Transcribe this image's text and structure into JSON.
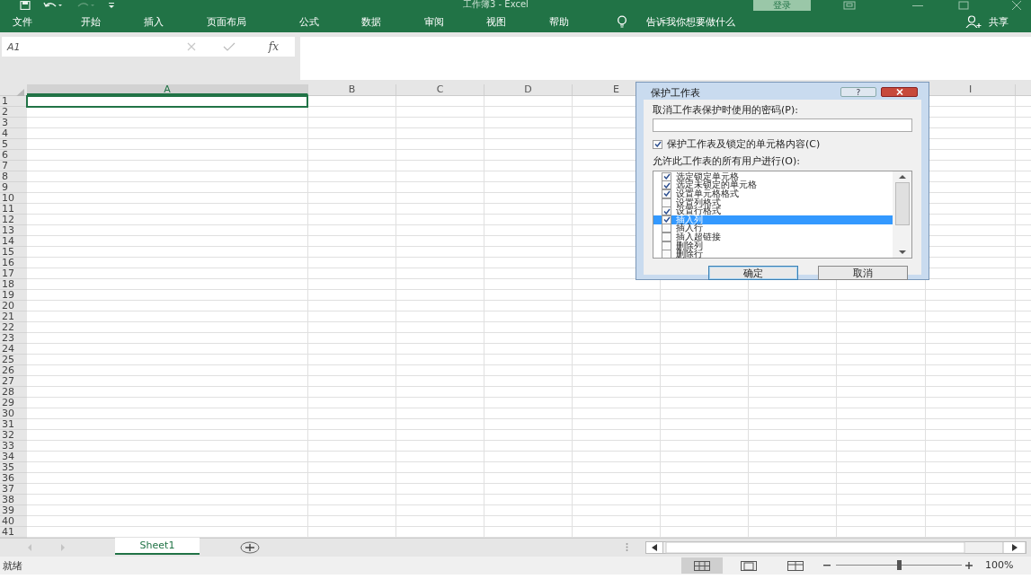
{
  "title_bar": {
    "title": "工作簿3  -  Excel",
    "sign_in": "登录"
  },
  "ribbon_tabs": [
    "文件",
    "开始",
    "插入",
    "页面布局",
    "公式",
    "数据",
    "审阅",
    "视图",
    "帮助"
  ],
  "tell_me": "告诉我你想要做什么",
  "share": "共享",
  "name_box": "A1",
  "formula_label": "fx",
  "columns": [
    {
      "label": "A",
      "selected": true
    },
    {
      "label": "B",
      "selected": false
    },
    {
      "label": "C",
      "selected": false
    },
    {
      "label": "D",
      "selected": false
    },
    {
      "label": "E",
      "selected": false
    },
    {
      "label": "I",
      "selected": false
    }
  ],
  "rows": [
    "1",
    "2",
    "3",
    "4",
    "5",
    "6",
    "7",
    "8",
    "9",
    "10",
    "11",
    "12",
    "13",
    "14",
    "15",
    "16",
    "17",
    "18",
    "19",
    "20",
    "21",
    "22",
    "23",
    "24",
    "25",
    "26",
    "27",
    "28",
    "29",
    "30",
    "31",
    "32",
    "33",
    "34",
    "35",
    "36",
    "37",
    "38",
    "39",
    "40",
    "41"
  ],
  "dialog": {
    "title": "保护工作表",
    "help": "?",
    "password_label": "取消工作表保护时使用的密码(P):",
    "protect_checkbox": {
      "label": "保护工作表及锁定的单元格内容(C)",
      "checked": true
    },
    "permissions_label": "允许此工作表的所有用户进行(O):",
    "permissions": [
      {
        "label": "选定锁定单元格",
        "checked": true,
        "selected": false
      },
      {
        "label": "选定未锁定的单元格",
        "checked": true,
        "selected": false
      },
      {
        "label": "设置单元格格式",
        "checked": true,
        "selected": false
      },
      {
        "label": "设置列格式",
        "checked": false,
        "selected": false
      },
      {
        "label": "设置行格式",
        "checked": true,
        "selected": false
      },
      {
        "label": "插入列",
        "checked": true,
        "selected": true
      },
      {
        "label": "插入行",
        "checked": false,
        "selected": false
      },
      {
        "label": "插入超链接",
        "checked": false,
        "selected": false
      },
      {
        "label": "删除列",
        "checked": false,
        "selected": false
      },
      {
        "label": "删除行",
        "checked": false,
        "selected": false
      }
    ],
    "ok": "确定",
    "cancel": "取消"
  },
  "sheets": [
    {
      "label": "Sheet1",
      "selected": true
    }
  ],
  "status": {
    "text": "就绪",
    "views": [
      {
        "kind": "normal",
        "selected": true
      },
      {
        "kind": "page_layout",
        "selected": false
      },
      {
        "kind": "page_break",
        "selected": false
      }
    ],
    "zoom": {
      "level": 0.5
    },
    "zoom_text": "100%"
  }
}
